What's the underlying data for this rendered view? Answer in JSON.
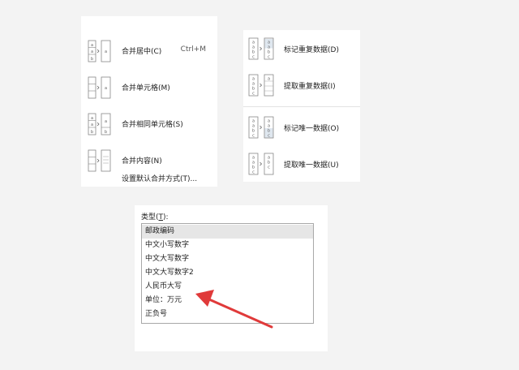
{
  "merge_menu": {
    "items": [
      {
        "label": "合并居中(C)",
        "shortcut": "Ctrl+M",
        "icon": "merge-center-icon"
      },
      {
        "label": "合并单元格(M)",
        "icon": "merge-cells-icon"
      },
      {
        "label": "合并相同单元格(S)",
        "icon": "merge-same-cells-icon"
      },
      {
        "label": "合并内容(N)",
        "icon": "merge-content-icon"
      }
    ],
    "default_label": "设置默认合并方式(T)..."
  },
  "dup_menu": {
    "items": [
      {
        "label": "标记重复数据(D)",
        "icon": "mark-duplicates-icon"
      },
      {
        "label": "提取重复数据(I)",
        "icon": "extract-duplicates-icon"
      },
      {
        "label": "标记唯一数据(O)",
        "icon": "mark-unique-icon"
      },
      {
        "label": "提取唯一数据(U)",
        "icon": "extract-unique-icon"
      }
    ]
  },
  "type_panel": {
    "label_prefix": "类型(",
    "label_key": "T",
    "label_suffix": "):",
    "options": [
      "邮政编码",
      "中文小写数字",
      "中文大写数字",
      "中文大写数字2",
      "人民币大写",
      "单位：万元",
      "正负号"
    ],
    "selected": "邮政编码"
  },
  "colors": {
    "annotation_arrow": "#e03a3a"
  }
}
